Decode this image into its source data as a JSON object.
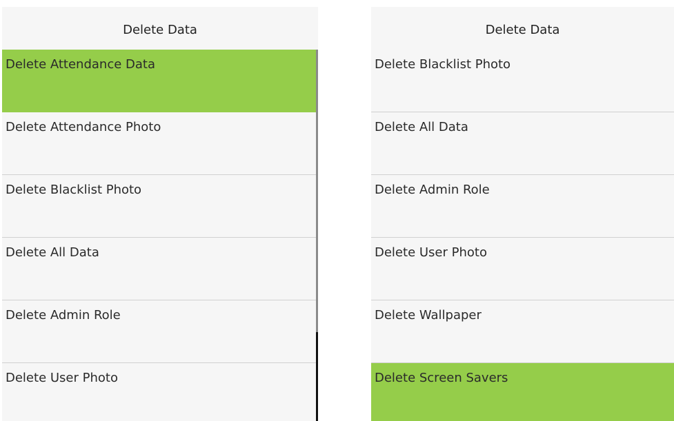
{
  "left_panel": {
    "title": "Delete Data",
    "items": [
      {
        "label": "Delete Attendance Data"
      },
      {
        "label": "Delete Attendance Photo"
      },
      {
        "label": "Delete Blacklist Photo"
      },
      {
        "label": "Delete All Data"
      },
      {
        "label": "Delete Admin Role"
      },
      {
        "label": "Delete User Photo"
      }
    ],
    "selected_index": 0
  },
  "right_panel": {
    "title": "Delete Data",
    "items": [
      {
        "label": "Delete Blacklist Photo"
      },
      {
        "label": "Delete All Data"
      },
      {
        "label": "Delete Admin Role"
      },
      {
        "label": "Delete User Photo"
      },
      {
        "label": "Delete Wallpaper"
      },
      {
        "label": "Delete Screen Savers"
      }
    ],
    "selected_index": 5
  },
  "colors": {
    "selected": "#95cd4a",
    "background": "#f6f6f6",
    "divider": "#d0d0d0"
  }
}
